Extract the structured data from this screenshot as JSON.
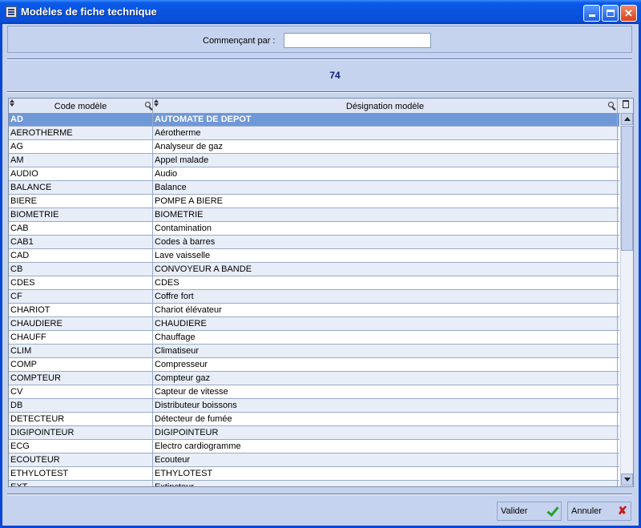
{
  "window": {
    "title": "Modèles de fiche technique"
  },
  "search": {
    "label": "Commençant par :",
    "value": "",
    "placeholder": ""
  },
  "count": "74",
  "grid": {
    "columns": [
      "Code modèle",
      "Désignation modèle"
    ],
    "rows": [
      [
        "AD",
        "AUTOMATE DE DEPOT"
      ],
      [
        "AEROTHERME",
        "Aérotherme"
      ],
      [
        "AG",
        "Analyseur de gaz"
      ],
      [
        "AM",
        "Appel malade"
      ],
      [
        "AUDIO",
        "Audio"
      ],
      [
        "BALANCE",
        "Balance"
      ],
      [
        "BIERE",
        "POMPE A BIERE"
      ],
      [
        "BIOMETRIE",
        "BIOMETRIE"
      ],
      [
        "CAB",
        "Contamination"
      ],
      [
        "CAB1",
        "Codes à barres"
      ],
      [
        "CAD",
        "Lave vaisselle"
      ],
      [
        "CB",
        "CONVOYEUR A BANDE"
      ],
      [
        "CDES",
        "CDES"
      ],
      [
        "CF",
        "Coffre fort"
      ],
      [
        "CHARIOT",
        "Chariot élévateur"
      ],
      [
        "CHAUDIERE",
        "CHAUDIERE"
      ],
      [
        "CHAUFF",
        "Chauffage"
      ],
      [
        "CLIM",
        "Climatiseur"
      ],
      [
        "COMP",
        "Compresseur"
      ],
      [
        "COMPTEUR",
        "Compteur gaz"
      ],
      [
        "CV",
        "Capteur de vitesse"
      ],
      [
        "DB",
        "Distributeur boissons"
      ],
      [
        "DETECTEUR",
        "Détecteur de fumée"
      ],
      [
        "DIGIPOINTEUR",
        "DIGIPOINTEUR"
      ],
      [
        "ECG",
        "Electro cardiogramme"
      ],
      [
        "ECOUTEUR",
        "Ecouteur"
      ],
      [
        "ETHYLOTEST",
        "ETHYLOTEST"
      ],
      [
        "EXT",
        "Extincteur"
      ]
    ],
    "selected_index": 0
  },
  "buttons": {
    "ok_label": "Valider",
    "cancel_label": "Annuler"
  },
  "colors": {
    "titlebar": "#0a5ae8",
    "selection": "#6f98d8",
    "panel": "#c6d3ef"
  }
}
